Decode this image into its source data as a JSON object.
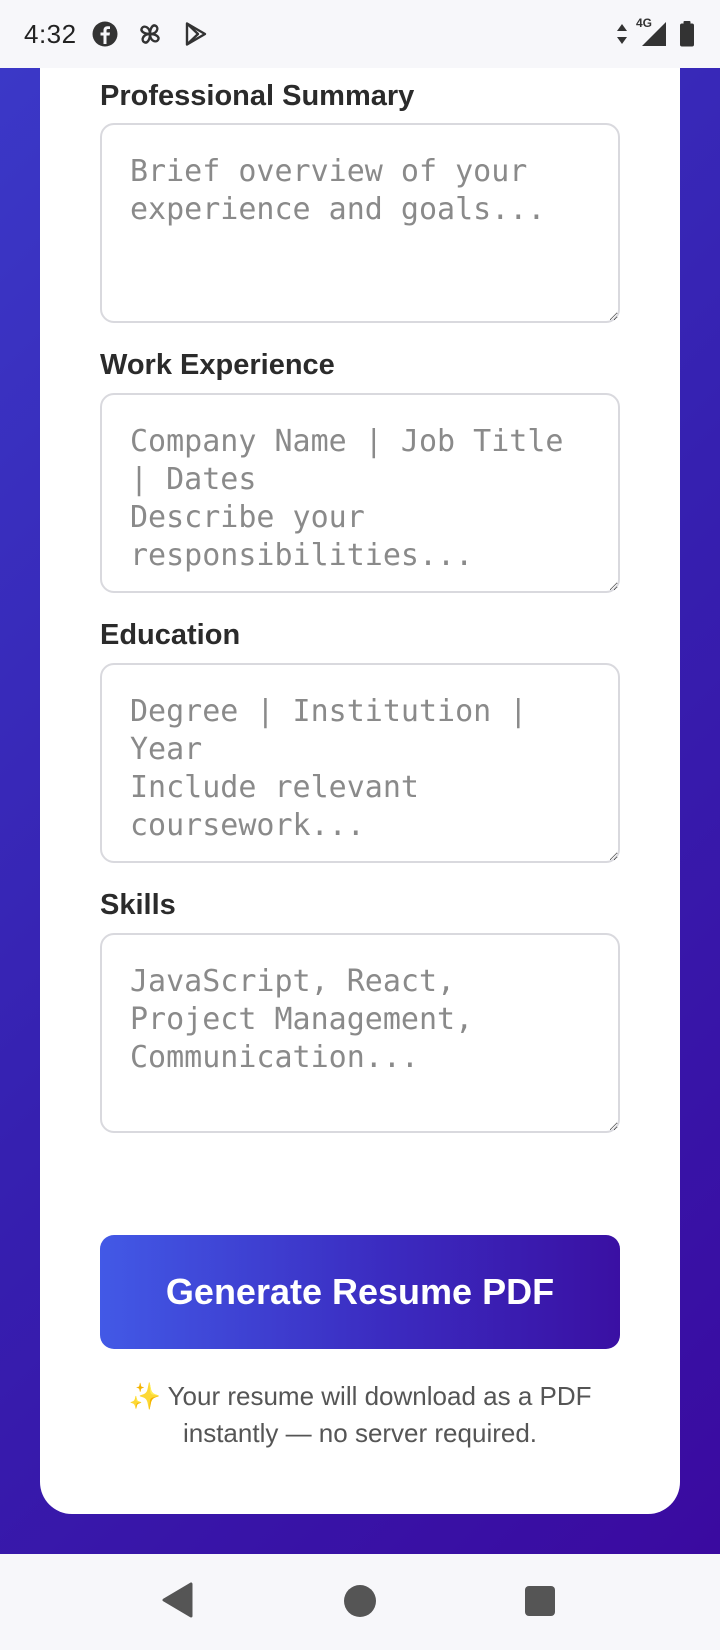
{
  "status_bar": {
    "time": "4:32",
    "network": "4G",
    "icons": [
      "facebook-icon",
      "pinwheel-icon",
      "play-store-icon",
      "data-arrows-icon",
      "signal-icon",
      "battery-icon"
    ]
  },
  "form": {
    "summary": {
      "label": "Professional Summary",
      "placeholder": "Brief overview of your experience and goals...",
      "value": ""
    },
    "experience": {
      "label": "Work Experience",
      "placeholder": "Company Name | Job Title | Dates\nDescribe your responsibilities...",
      "value": ""
    },
    "education": {
      "label": "Education",
      "placeholder": "Degree | Institution | Year\nInclude relevant coursework...",
      "value": ""
    },
    "skills": {
      "label": "Skills",
      "placeholder": "JavaScript, React, Project Management, Communication...",
      "value": ""
    }
  },
  "generate_button": {
    "label": "Generate Resume PDF"
  },
  "note": {
    "text": "✨ Your resume will download as a PDF instantly — no server required."
  },
  "colors": {
    "accent_start": "#4259e6",
    "accent_end": "#3a10a3",
    "background": "#3620b0"
  },
  "nav": {
    "icons": [
      "back-icon",
      "home-icon",
      "recents-icon"
    ]
  }
}
